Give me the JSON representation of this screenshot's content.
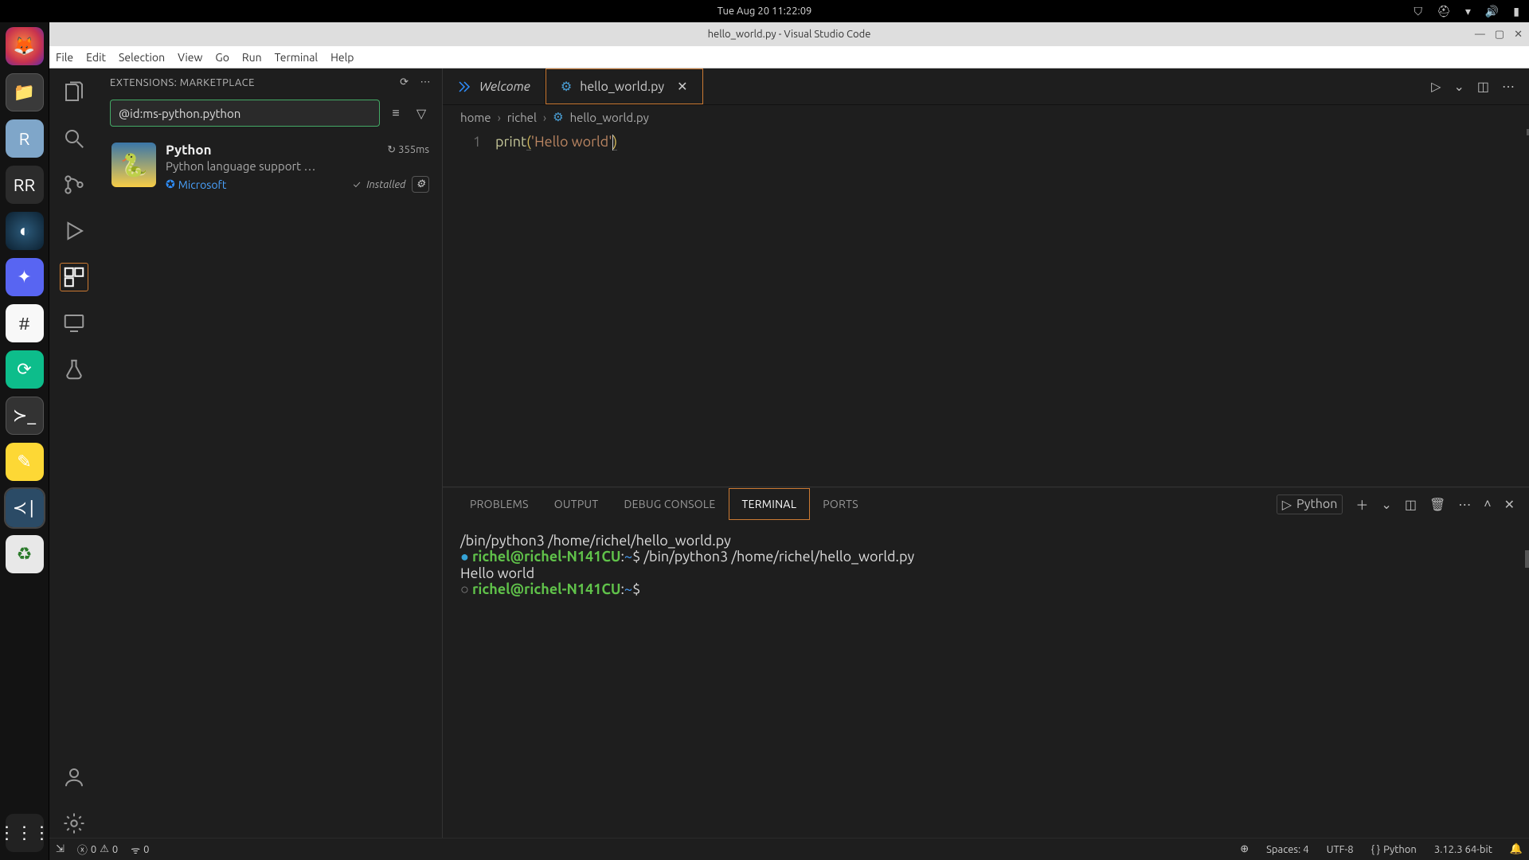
{
  "system": {
    "clock": "Tue Aug 20  11:22:09"
  },
  "window": {
    "title": "hello_world.py - Visual Studio Code"
  },
  "menu": {
    "file": "File",
    "edit": "Edit",
    "selection": "Selection",
    "view": "View",
    "go": "Go",
    "run": "Run",
    "terminal": "Terminal",
    "help": "Help"
  },
  "sidebar": {
    "title": "EXTENSIONS: MARKETPLACE",
    "search_value": "@id:ms-python.python",
    "extension": {
      "name": "Python",
      "time": "355ms",
      "desc": "Python language support …",
      "publisher": "Microsoft",
      "installed": "Installed"
    }
  },
  "tabs": {
    "welcome": "Welcome",
    "file": "hello_world.py"
  },
  "breadcrumb": {
    "seg1": "home",
    "seg2": "richel",
    "seg3": "hello_world.py"
  },
  "code": {
    "line1_fn": "print",
    "line1_str": "'Hello world'",
    "lineno1": "1"
  },
  "panel": {
    "problems": "PROBLEMS",
    "output": "OUTPUT",
    "debug": "DEBUG CONSOLE",
    "terminal": "TERMINAL",
    "ports": "PORTS",
    "kernel": "Python"
  },
  "terminal": {
    "l1": "/bin/python3 /home/richel/hello_world.py",
    "prompt_user": "richel@richel-N141CU",
    "prompt_tail": ":~$",
    "cmd": " /bin/python3 /home/richel/hello_world.py",
    "out": "Hello world"
  },
  "status": {
    "errors": "0",
    "warnings": "0",
    "ports": "0",
    "spaces": "Spaces: 4",
    "encoding": "UTF-8",
    "lang": "Python",
    "version": "3.12.3 64-bit"
  }
}
